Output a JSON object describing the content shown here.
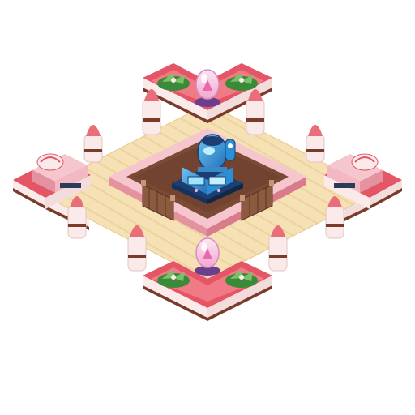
{
  "scene": {
    "background": "#ffffff",
    "palette": {
      "floor": "#f5e1b4",
      "floor_stripe": "#ecd29e",
      "cake_top": "#e45565",
      "cake_top_light": "#f07a86",
      "cake_side": "#f8ecec",
      "cake_layer": "#7a3b2a",
      "pink_wall": "#f3b9c2",
      "pink_wall_dark": "#e592a0",
      "chocolate": "#7a4a35",
      "chocolate_dark": "#5b3426",
      "machine_blue": "#2b8fd6",
      "machine_dark": "#1b3f73",
      "plant": "#3a8a3a",
      "plant_light": "#79c26a",
      "strawberry": "#ea6d7a",
      "cream": "#fbeaea",
      "crystal": "#f6b3d6"
    },
    "objects": [
      {
        "name": "center-machine",
        "icon": "robot-machine-icon"
      },
      {
        "name": "north-pod",
        "icon": "crystal-pod-icon"
      },
      {
        "name": "south-pod",
        "icon": "crystal-pod-icon"
      },
      {
        "name": "west-cake-shop",
        "icon": "cake-shop-icon"
      },
      {
        "name": "east-cake-shop",
        "icon": "cake-shop-icon"
      }
    ]
  }
}
